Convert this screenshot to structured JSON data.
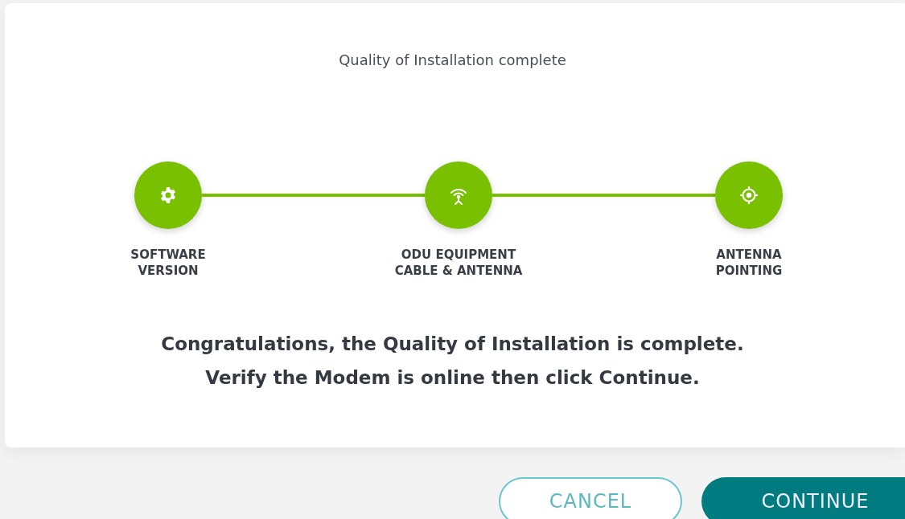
{
  "dialog": {
    "title": "Quality of Installation complete",
    "steps": [
      {
        "kind": "gear",
        "label": "SOFTWARE\nVERSION",
        "done": true
      },
      {
        "kind": "antenna",
        "label": "ODU EQUIPMENT\nCABLE & ANTENNA",
        "done": true
      },
      {
        "kind": "target",
        "label": "ANTENNA\nPOINTING",
        "done": true
      }
    ],
    "message": [
      "Congratulations, the Quality of Installation is complete.",
      "Verify the Modem is online then click Continue."
    ]
  },
  "buttons": [
    {
      "kind": "secondary",
      "label": "CANCEL"
    },
    {
      "kind": "primary",
      "label": "CONTINUE"
    }
  ]
}
